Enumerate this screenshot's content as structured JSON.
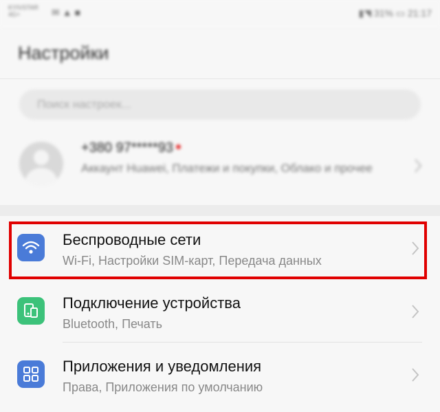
{
  "status_bar": {
    "carrier_line1": "KYIVSTAR",
    "carrier_line2": "4G+",
    "battery": "31%",
    "time": "21:17"
  },
  "header": {
    "title": "Настройки"
  },
  "search": {
    "placeholder": "Поиск настроек..."
  },
  "account": {
    "number": "+380 97*****93",
    "subtitle": "Аккаунт Huawei, Платежи и покупки, Облако и прочее"
  },
  "settings_items": [
    {
      "title": "Беспроводные сети",
      "subtitle": "Wi-Fi, Настройки SIM-карт, Передача данных",
      "icon": "wifi-icon",
      "icon_color": "#4a7bd8"
    },
    {
      "title": "Подключение устройства",
      "subtitle": "Bluetooth, Печать",
      "icon": "device-connection-icon",
      "icon_color": "#3cc27a"
    },
    {
      "title": "Приложения и уведомления",
      "subtitle": "Права, Приложения по умолчанию",
      "icon": "apps-icon",
      "icon_color": "#4a7bd8"
    }
  ],
  "highlight_color": "#e00000"
}
